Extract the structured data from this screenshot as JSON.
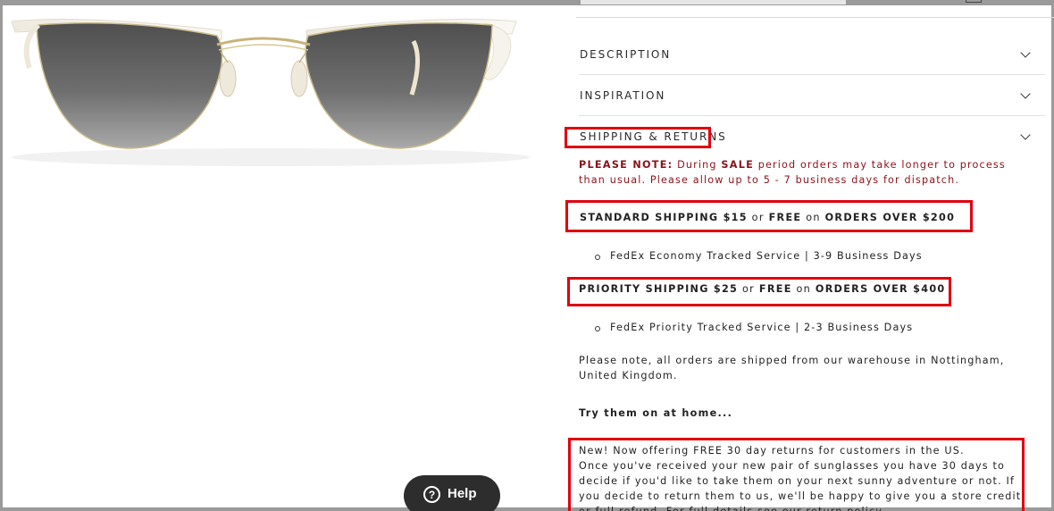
{
  "accordion": {
    "description": "DESCRIPTION",
    "inspiration": "INSPIRATION",
    "shipping": "SHIPPING & RETURNS"
  },
  "shipping": {
    "note_label": "PLEASE NOTE:",
    "note_text_1": " During ",
    "note_sale": "SALE",
    "note_text_2": " period orders may take longer to process than usual. Please allow up to 5 - 7 business days for dispatch.",
    "standard": {
      "label": "STANDARD SHIPPING $15",
      "or": " or ",
      "free": "FREE",
      "on": " on ",
      "threshold": "ORDERS OVER $200",
      "service": "FedEx Economy Tracked Service | 3-9 Business Days"
    },
    "priority": {
      "label": "PRIORITY SHIPPING $25",
      "or": " or ",
      "free": "FREE",
      "on": " on ",
      "threshold": "ORDERS OVER $400",
      "service": "FedEx Priority Tracked Service | 2-3 Business Days"
    },
    "warehouse_note": "Please note, all orders are shipped from our warehouse in Nottingham, United Kingdom.",
    "try_heading": "Try them on at home...",
    "returns_1": "New! Now offering FREE 30 day returns for customers in the US.",
    "returns_2": "Once you've received your new pair of sunglasses you have 30 days to decide if you'd like to take them on your next sunny adventure or not. If you decide to return them to us, we'll be happy to give you a store credit or full refund. For full details see our return policy."
  },
  "help": {
    "label": "Help",
    "icon": "question-circle-icon"
  },
  "colors": {
    "highlight": "#e0000f",
    "note": "#8a1218",
    "help_bg": "#2d2d2d"
  }
}
